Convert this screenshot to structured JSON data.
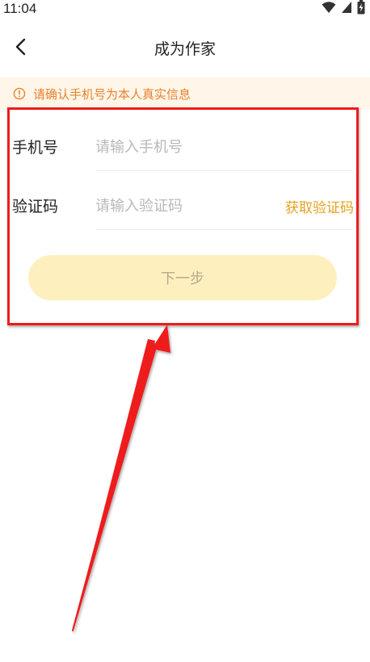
{
  "status_bar": {
    "time": "11:04",
    "icons": [
      "wifi-icon",
      "signal-icon",
      "battery-icon"
    ]
  },
  "nav": {
    "title": "成为作家",
    "back_icon": "chevron-left-icon"
  },
  "notice": {
    "icon": "info-circle-icon",
    "text": "请确认手机号为本人真实信息"
  },
  "form": {
    "phone": {
      "label": "手机号",
      "placeholder": "请输入手机号",
      "value": ""
    },
    "code": {
      "label": "验证码",
      "placeholder": "请输入验证码",
      "value": "",
      "get_code_label": "获取验证码"
    },
    "next_label": "下一步"
  },
  "colors": {
    "accent": "#e6a11c",
    "notice_text": "#e6822d",
    "notice_bg": "#fff6e9",
    "button_bg": "#fdf0be",
    "annotation_red": "#ee1c1c"
  }
}
